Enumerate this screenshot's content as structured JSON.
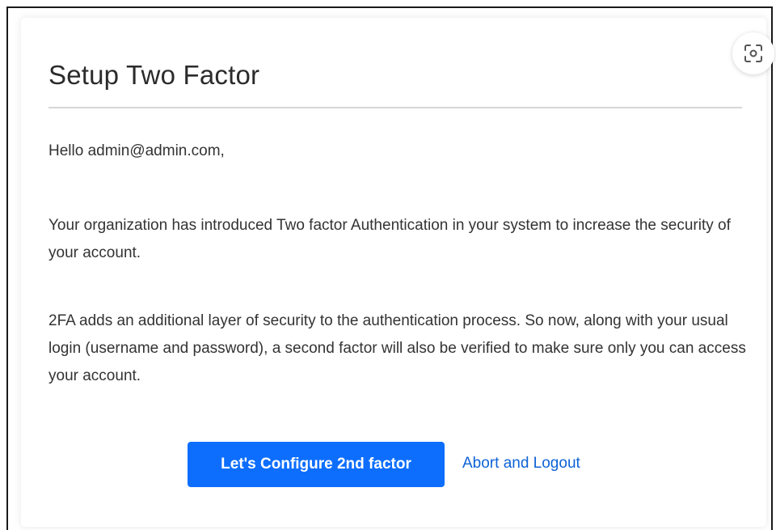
{
  "card": {
    "title": "Setup Two Factor",
    "greeting": "Hello admin@admin.com,",
    "paragraph_1": "Your organization has introduced Two factor Authentication in your system to increase the security of your account.",
    "paragraph_2": "2FA adds an additional layer of security to the authentication process. So now, along with your usual login (username and password), a second factor will also be verified to make sure only you can access your account.",
    "primary_button_label": "Let's Configure 2nd factor",
    "abort_link_label": "Abort and Logout"
  },
  "icons": {
    "scan": "screenshot-scan-icon"
  },
  "colors": {
    "primary": "#0d6efd",
    "link": "#0d62d6",
    "text": "#333333",
    "divider": "#d6d6d6"
  }
}
